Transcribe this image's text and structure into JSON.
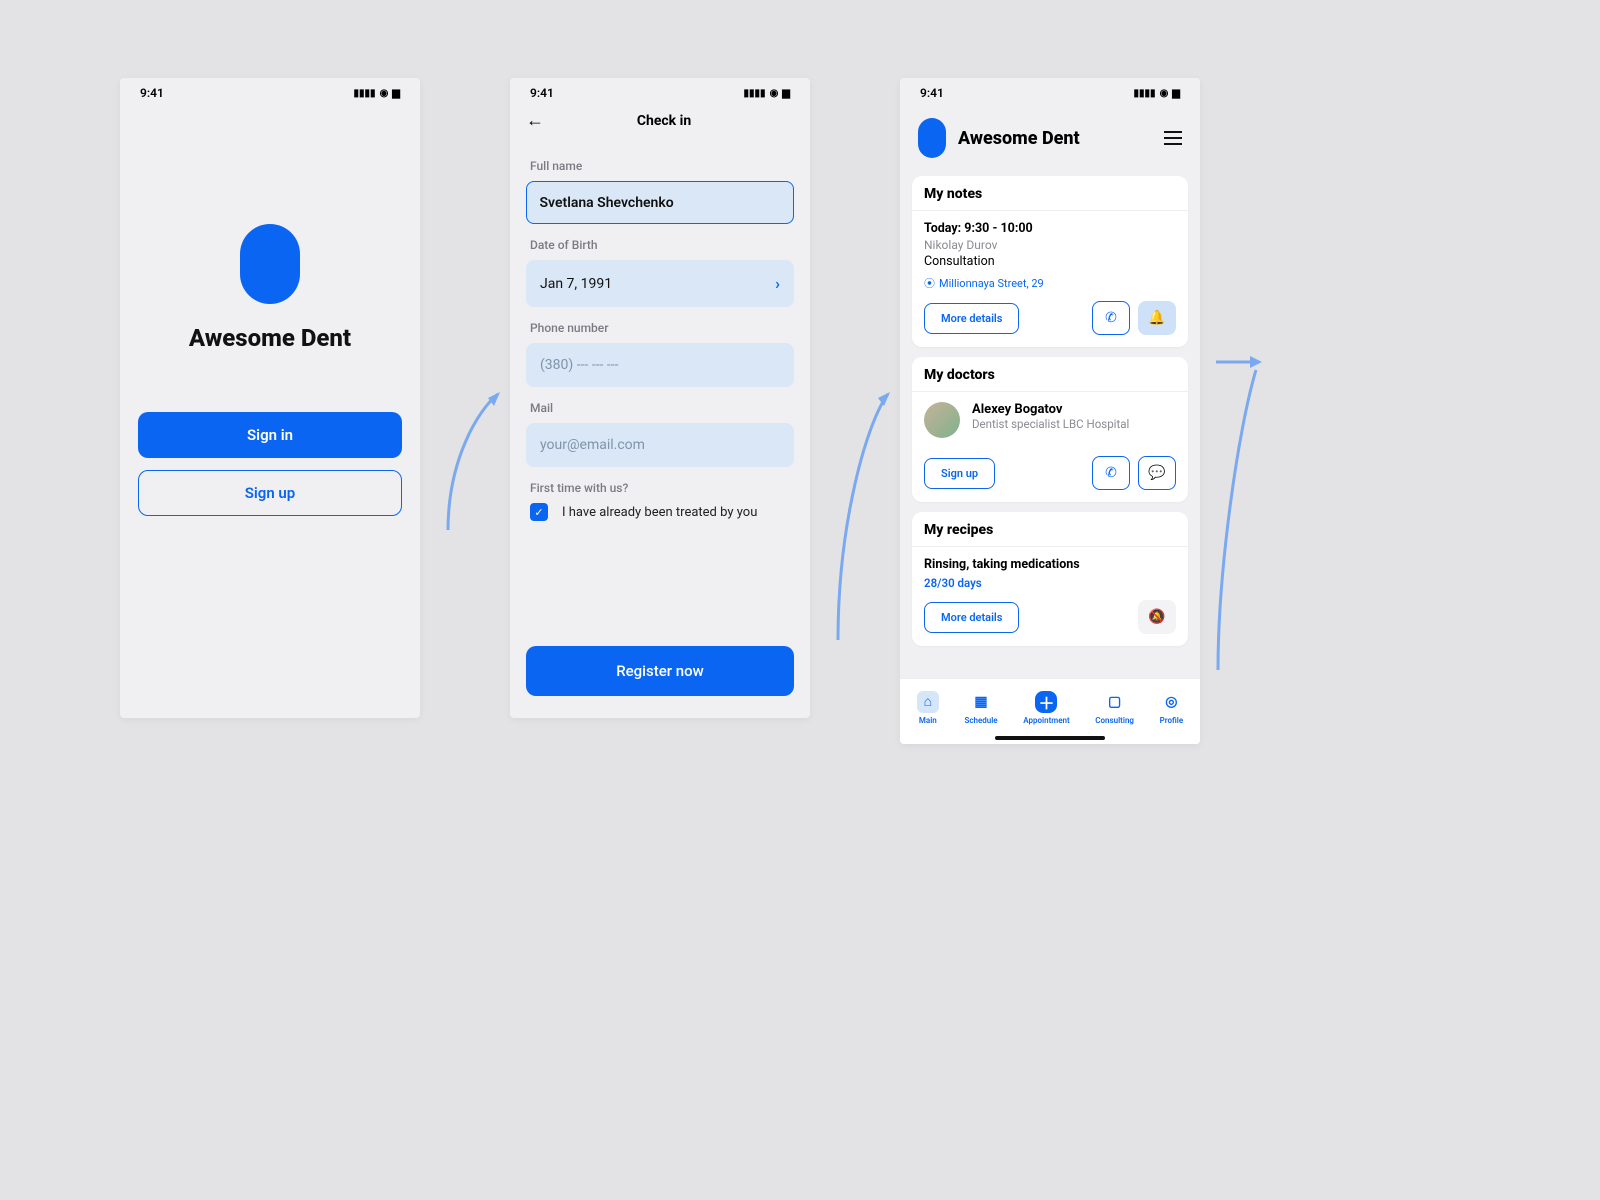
{
  "status_time": "9:41",
  "brand": "Awesome Dent",
  "colors": {
    "accent": "#0a66f2"
  },
  "screen1": {
    "sign_in": "Sign in",
    "sign_up": "Sign up"
  },
  "screen2": {
    "title": "Check in",
    "full_name_label": "Full name",
    "full_name_value": "Svetlana Shevchenko",
    "dob_label": "Date of Birth",
    "dob_value": "Jan 7, 1991",
    "phone_label": "Phone number",
    "phone_placeholder": "(380) --- --- ---",
    "mail_label": "Mail",
    "mail_placeholder": "your@email.com",
    "first_time_label": "First time with us?",
    "checkbox_text": "I have already been treated by you",
    "register_btn": "Register now"
  },
  "screen3": {
    "notes": {
      "head": "My notes",
      "today_line": "Today: 9:30 - 10:00",
      "person": "Nikolay Durov",
      "type": "Consultation",
      "address": "Millionnaya Street, 29",
      "more_details": "More details"
    },
    "doctors": {
      "head": "My doctors",
      "name": "Alexey Bogatov",
      "subtitle": "Dentist specialist LBC Hospital",
      "signup": "Sign up"
    },
    "recipes": {
      "head": "My recipes",
      "title": "Rinsing, taking medications",
      "progress": "28/30 days",
      "more_details": "More details"
    },
    "tabs": {
      "main": "Main",
      "schedule": "Schedule",
      "appointment": "Appointment",
      "consulting": "Consulting",
      "profile": "Profile"
    }
  }
}
